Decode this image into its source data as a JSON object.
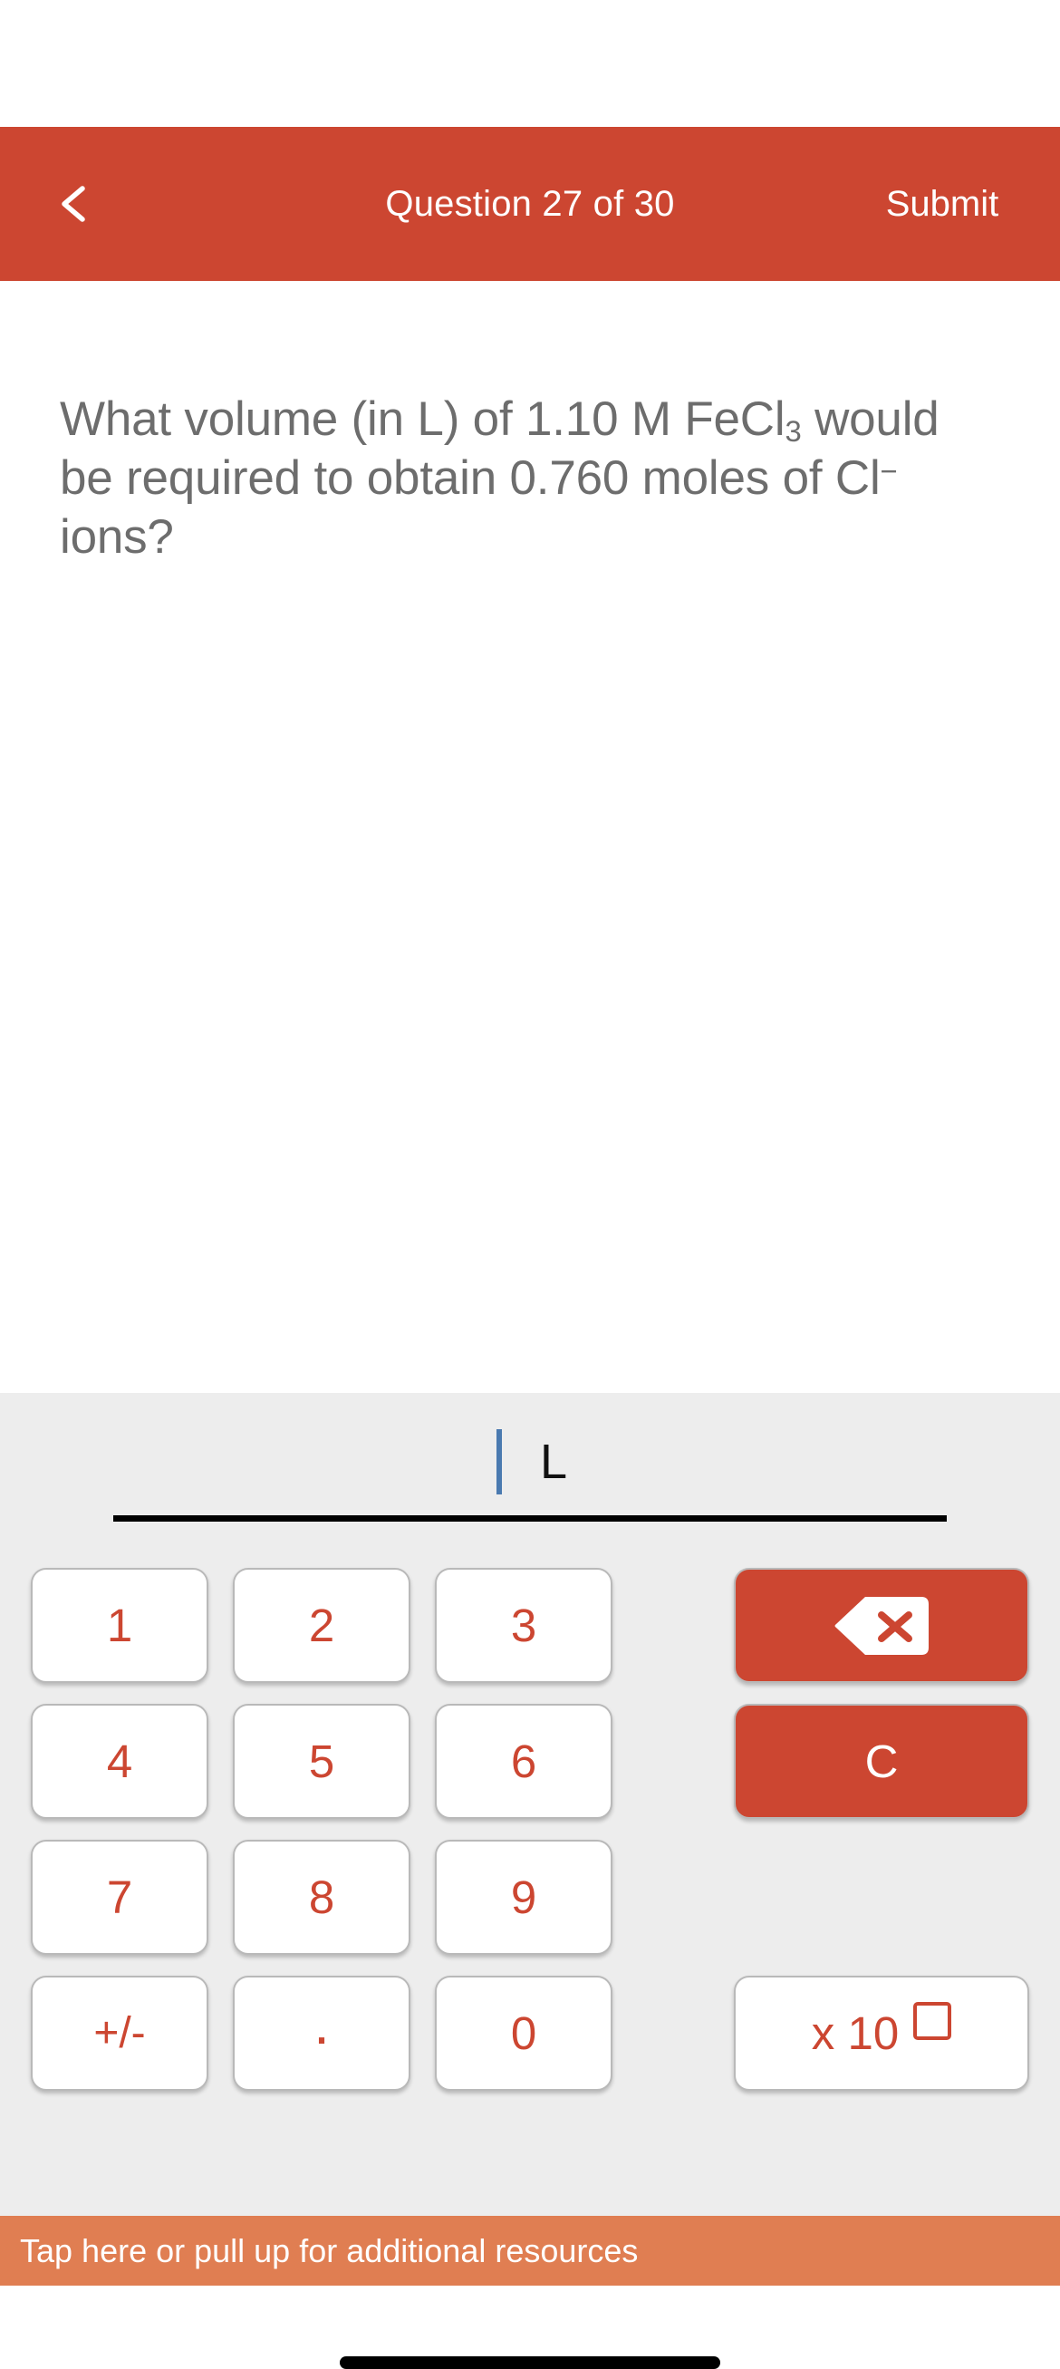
{
  "header": {
    "back_icon": "chevron-left-icon",
    "title": "Question 27 of 30",
    "submit_label": "Submit",
    "background_color": "#CC4631",
    "text_color": "#FFFFFF"
  },
  "question": {
    "line1_prefix": "What volume (in L) of 1.10 M FeCl",
    "line1_sub": "3",
    "line1_suffix": " would be required to obtain 0.760 moles of Cl",
    "line1_sup": "−",
    "line1_end": " ions?",
    "full_text": "What volume (in L) of 1.10 M FeCl3 would be required to obtain 0.760 moles of Cl- ions?",
    "text_color": "#6D6D6D"
  },
  "answer": {
    "value": "",
    "caret_color": "#4A7AB0",
    "unit": "L",
    "underline_color": "#000000"
  },
  "keypad": {
    "background_color": "#EDEDED",
    "key_text_color": "#CC4631",
    "keys": [
      {
        "name": "key-1",
        "label": "1"
      },
      {
        "name": "key-2",
        "label": "2"
      },
      {
        "name": "key-3",
        "label": "3"
      },
      {
        "name": "key-4",
        "label": "4"
      },
      {
        "name": "key-5",
        "label": "5"
      },
      {
        "name": "key-6",
        "label": "6"
      },
      {
        "name": "key-7",
        "label": "7"
      },
      {
        "name": "key-8",
        "label": "8"
      },
      {
        "name": "key-9",
        "label": "9"
      },
      {
        "name": "key-plus-minus",
        "label": "+/-"
      },
      {
        "name": "key-decimal",
        "label": "."
      },
      {
        "name": "key-0",
        "label": "0"
      }
    ],
    "backspace": {
      "icon": "backspace-delete-icon",
      "background_color": "#CC4631"
    },
    "clear": {
      "label": "C",
      "background_color": "#CC4631",
      "text_color": "#FFFFFF"
    },
    "exponent": {
      "label": "x 10",
      "box_icon": "empty-exponent-box-icon",
      "text_color": "#CC4631"
    }
  },
  "resources": {
    "label": "Tap here or pull up for additional resources",
    "background_color": "#E07E52",
    "text_color": "#FFFFFF"
  }
}
